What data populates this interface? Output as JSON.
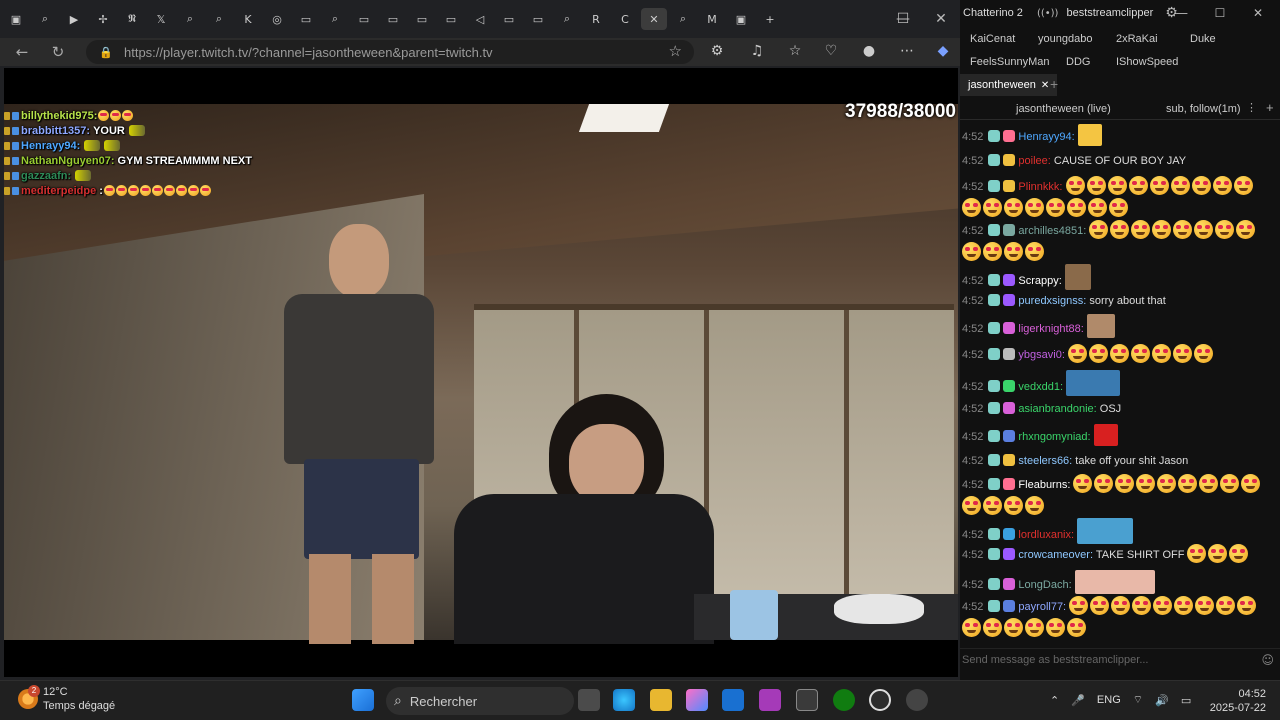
{
  "browser": {
    "url": "https://player.twitch.tv/?channel=jasontheween&parent=twitch.tv",
    "tabs": [
      "▣",
      "⌕",
      "▶",
      "✢",
      "𝕹",
      "𝕏",
      "⌕",
      "⌕",
      "K",
      "◎",
      "▭",
      "⌕",
      "▭",
      "▭",
      "▭",
      "▭",
      "◁",
      "▭",
      "▭",
      "⌕",
      "R",
      "C",
      "✕",
      "⌕",
      "M",
      "▣",
      "+"
    ]
  },
  "stream": {
    "viewer_count": "37988/38000",
    "overlay_chat": [
      {
        "user": "billythekid975:",
        "color": "#b7e24a",
        "msg": "",
        "emotes": 3
      },
      {
        "user": "brabbitt1357:",
        "color": "#8fa8ff",
        "msg": "YOUR",
        "emotes": 0,
        "img": true
      },
      {
        "user": "Henrayy94:",
        "color": "#4fa8ff",
        "msg": "",
        "emotes": 0,
        "img": true
      },
      {
        "user": "NathanNguyen07:",
        "color": "#9acd32",
        "msg": "GYM STREAMMMM NEXT",
        "emotes": 0
      },
      {
        "user": "gazzaafn:",
        "color": "#2e8b57",
        "msg": "",
        "emotes": 0,
        "img": true
      },
      {
        "user": "mediterpeidpe",
        "color": "#d43030",
        "msg": ":",
        "emotes": 9
      }
    ]
  },
  "chatterino": {
    "app_title": "Chatterino 2",
    "account": "beststreamclipper",
    "tabs_row1": [
      "KaiCenat",
      "youngdabo",
      "2xRaKai",
      "Duke"
    ],
    "tabs_row2": [
      "FeelsSunnyMan",
      "DDG",
      "IShowSpeed"
    ],
    "active_tab": "jasontheween",
    "channel_header": "jasontheween (live)",
    "channel_mode": "sub, follow(1m)",
    "input_placeholder": "Send message as beststreamclipper...",
    "messages": [
      {
        "ts": "4:52",
        "user": "Henrayy94:",
        "color": "#4fa8ff",
        "text": ""
      },
      {
        "ts": "4:52",
        "user": "poilee:",
        "color": "#e0302e",
        "text": "CAUSE OF OUR BOY JAY"
      },
      {
        "ts": "4:52",
        "user": "Plinnkkk:",
        "color": "#e0302e",
        "text": ""
      },
      {
        "ts": "4:52",
        "user": "archilles4851:",
        "color": "#7aa8a0",
        "text": ""
      },
      {
        "ts": "4:52",
        "user": "Scrappy:",
        "color": "#ffffff",
        "text": ""
      },
      {
        "ts": "4:52",
        "user": "puredxsignss:",
        "color": "#8fc8ff",
        "text": "sorry about that"
      },
      {
        "ts": "4:52",
        "user": "ligerknight88:",
        "color": "#d860d8",
        "text": ""
      },
      {
        "ts": "4:52",
        "user": "ybgsavi0:",
        "color": "#c060e0",
        "text": ""
      },
      {
        "ts": "4:52",
        "user": "vedxdd1:",
        "color": "#3ad46a",
        "text": ""
      },
      {
        "ts": "4:52",
        "user": "asianbrandonie:",
        "color": "#3ad46a",
        "text": "OSJ"
      },
      {
        "ts": "4:52",
        "user": "rhxngomyniad:",
        "color": "#3ad46a",
        "text": ""
      },
      {
        "ts": "4:52",
        "user": "steelers66:",
        "color": "#8fc8ff",
        "text": "take off your shit Jason"
      },
      {
        "ts": "4:52",
        "user": "Fleaburns:",
        "color": "#ffffff",
        "text": ""
      },
      {
        "ts": "4:52",
        "user": "lordluxanix:",
        "color": "#e0302e",
        "text": ""
      },
      {
        "ts": "4:52",
        "user": "crowcameover:",
        "color": "#8fc8ff",
        "text": "TAKE SHIRT OFF"
      },
      {
        "ts": "4:52",
        "user": "LongDach:",
        "color": "#7aa8a0",
        "text": ""
      },
      {
        "ts": "4:52",
        "user": "payroll77:",
        "color": "#8fa8ff",
        "text": ""
      }
    ]
  },
  "taskbar": {
    "weather_temp": "12°C",
    "weather_desc": "Temps dégagé",
    "weather_badge": "2",
    "search_label": "Rechercher",
    "lang": "ENG",
    "time": "04:52",
    "date": "2025-07-22"
  }
}
